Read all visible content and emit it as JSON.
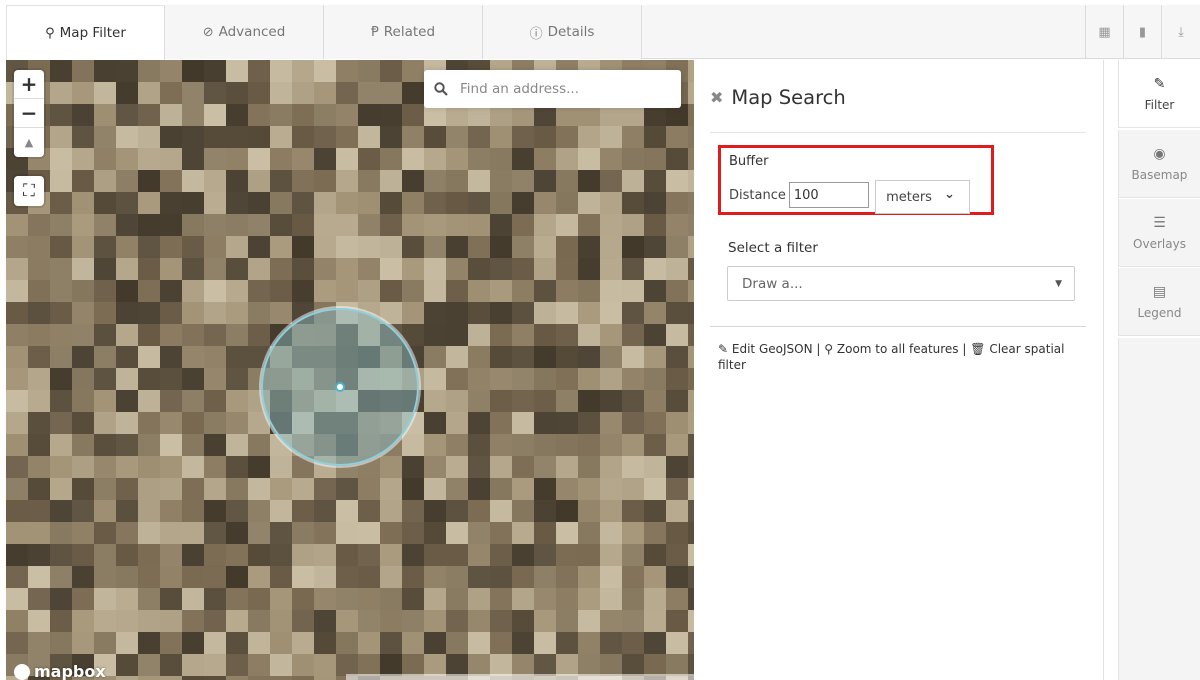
{
  "tabs": [
    {
      "label": "Map Filter",
      "icon": "map-marker-icon",
      "glyph": "⚲",
      "active": true
    },
    {
      "label": "Advanced",
      "icon": "check-circle-icon",
      "glyph": "⊘",
      "active": false
    },
    {
      "label": "Related",
      "icon": "code-fork-icon",
      "glyph": "Ᵽ",
      "active": false
    },
    {
      "label": "Details",
      "icon": "info-circle-icon",
      "glyph": "ⓘ",
      "active": false
    }
  ],
  "toolbar": {
    "calendar_icon": "▦",
    "bookmark_icon": "▮",
    "download_icon": "⤓"
  },
  "map": {
    "search_placeholder": "Find an address...",
    "zoom_in": "+",
    "zoom_out": "−",
    "compass": "▲",
    "fullscreen": "⛶",
    "attribution_logo": "mapbox"
  },
  "panel": {
    "title": "Map Search",
    "close_glyph": "✖",
    "buffer": {
      "label": "Buffer",
      "distance_label": "Distance",
      "distance_value": "100",
      "unit": "meters",
      "unit_caret": "⌄"
    },
    "filter": {
      "label": "Select a filter",
      "placeholder": "Draw a...",
      "caret": "▼"
    },
    "actions": {
      "edit_geojson": "Edit GeoJSON",
      "zoom_all": "Zoom to all features",
      "clear_spatial": "Clear spatial filter",
      "separator": "|"
    }
  },
  "rail": [
    {
      "label": "Filter",
      "icon": "pencil-icon",
      "glyph": "✎",
      "active": true
    },
    {
      "label": "Basemap",
      "icon": "globe-icon",
      "glyph": "◉",
      "active": false
    },
    {
      "label": "Overlays",
      "icon": "list-icon",
      "glyph": "☰",
      "active": false
    },
    {
      "label": "Legend",
      "icon": "legend-icon",
      "glyph": "▤",
      "active": false
    }
  ],
  "colors": {
    "highlight_border": "#e01c1c",
    "buffer_fill": "#8cbec8",
    "buffer_stroke": "#8fd0de"
  }
}
